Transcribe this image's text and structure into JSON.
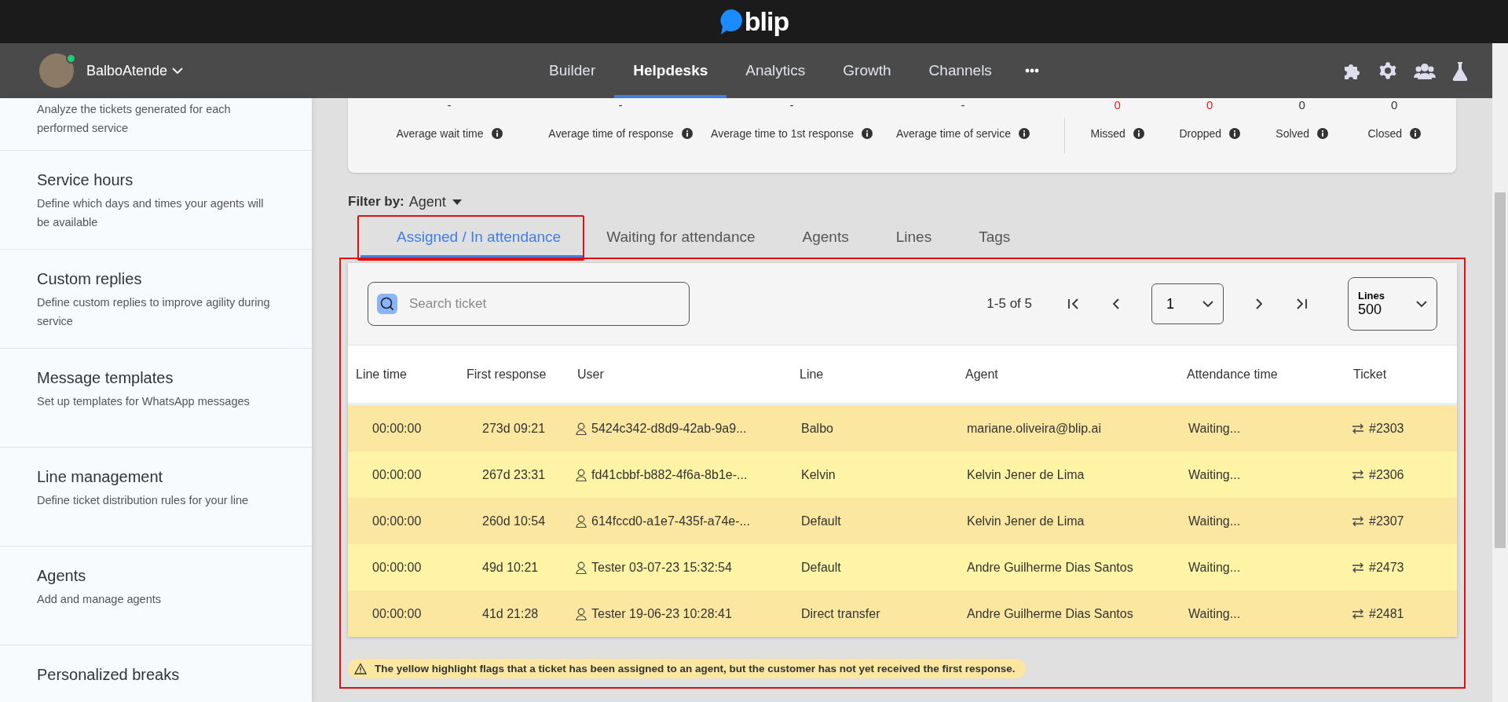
{
  "brand": {
    "logo": "blip"
  },
  "nav": {
    "account": "BalboAtende",
    "online": true,
    "items": [
      {
        "label": "Builder",
        "selected": false
      },
      {
        "label": "Helpdesks",
        "selected": true
      },
      {
        "label": "Analytics",
        "selected": false
      },
      {
        "label": "Growth",
        "selected": false
      },
      {
        "label": "Channels",
        "selected": false
      }
    ]
  },
  "sidebar": {
    "items": [
      {
        "description": "Analyze the tickets generated for each performed service"
      },
      {
        "title": "Service hours",
        "description": "Define which days and times your agents will be available"
      },
      {
        "title": "Custom replies",
        "description": "Define custom replies to improve agility during service"
      },
      {
        "title": "Message templates",
        "description": "Set up templates for WhatsApp messages"
      },
      {
        "title": "Line management",
        "description": "Define ticket distribution rules for your line"
      },
      {
        "title": "Agents",
        "description": "Add and manage agents"
      },
      {
        "title": "Personalized breaks"
      }
    ]
  },
  "stats": {
    "times": [
      {
        "value": "-",
        "label": "Average wait time",
        "alert": false
      },
      {
        "value": "-",
        "label": "Average time of response",
        "alert": false
      },
      {
        "value": "-",
        "label": "Average time to 1st response",
        "alert": false
      },
      {
        "value": "-",
        "label": "Average time of service",
        "alert": false
      }
    ],
    "counts": [
      {
        "value": "0",
        "label": "Missed",
        "alert": true
      },
      {
        "value": "0",
        "label": "Dropped",
        "alert": true
      },
      {
        "value": "0",
        "label": "Solved",
        "alert": false
      },
      {
        "value": "0",
        "label": "Closed",
        "alert": false
      }
    ]
  },
  "filter": {
    "label": "Filter by:",
    "value": "Agent"
  },
  "tabs": [
    {
      "label": "Assigned / In attendance",
      "selected": true
    },
    {
      "label": "Waiting for attendance",
      "selected": false
    },
    {
      "label": "Agents",
      "selected": false
    },
    {
      "label": "Lines",
      "selected": false
    },
    {
      "label": "Tags",
      "selected": false
    }
  ],
  "table": {
    "search": {
      "placeholder": "Search ticket"
    },
    "range": "1-5 of 5",
    "page": "1",
    "lines": {
      "label": "Lines",
      "value": "500"
    },
    "columns": [
      "Line time",
      "First response",
      "User",
      "Line",
      "Agent",
      "Attendance time",
      "Ticket"
    ],
    "rows": [
      {
        "highlighted": true,
        "cells": [
          "00:00:00",
          "273d 09:21",
          "5424c342-d8d9-42ab-9a9...",
          "Balbo",
          "mariane.oliveira@blip.ai",
          "Waiting...",
          "#2303"
        ]
      },
      {
        "highlighted": true,
        "cells": [
          "00:00:00",
          "267d 23:31",
          "fd41cbbf-b882-4f6a-8b1e-...",
          "Kelvin",
          "Kelvin Jener de Lima",
          "Waiting...",
          "#2306"
        ]
      },
      {
        "highlighted": true,
        "cells": [
          "00:00:00",
          "260d 10:54",
          "614fccd0-a1e7-435f-a74e-...",
          "Default",
          "Kelvin Jener de Lima",
          "Waiting...",
          "#2307"
        ]
      },
      {
        "highlighted": true,
        "cells": [
          "00:00:00",
          "49d 10:21",
          "Tester 03-07-23 15:32:54",
          "Default",
          "Andre Guilherme Dias Santos",
          "Waiting...",
          "#2473"
        ]
      },
      {
        "highlighted": true,
        "cells": [
          "00:00:00",
          "41d 21:28",
          "Tester 19-06-23 10:28:41",
          "Direct transfer",
          "Andre Guilherme Dias Santos",
          "Waiting...",
          "#2481"
        ]
      }
    ]
  },
  "note": "The yellow highlight flags that a ticket has been assigned to an agent, but the customer has not yet received the first response."
}
